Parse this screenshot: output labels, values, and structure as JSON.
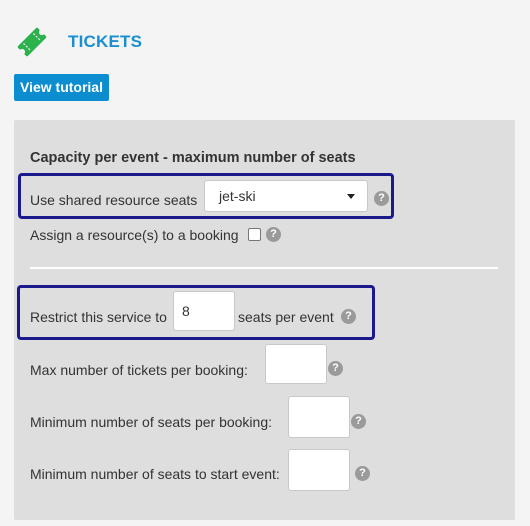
{
  "header": {
    "title": "TICKETS",
    "icon": "ticket-icon",
    "icon_color": "#2bb24c",
    "title_color": "#1a8fd0"
  },
  "toolbar": {
    "tutorial_label": "View tutorial"
  },
  "capacity": {
    "section_title": "Capacity per event - maximum number of seats",
    "shared_resource_label": "Use shared resource seats",
    "shared_resource_value": "jet-ski",
    "assign_resource_label": "Assign a resource(s) to a booking",
    "assign_resource_checked": false,
    "restrict_prefix": "Restrict this service to",
    "restrict_value": "8",
    "restrict_suffix": "seats per event",
    "max_tickets_label": "Max number of tickets per booking:",
    "max_tickets_value": "",
    "min_seats_label": "Minimum number of seats per booking:",
    "min_seats_value": "",
    "min_start_label": "Minimum number of seats to start event:",
    "min_start_value": "",
    "help_glyph": "?"
  },
  "colors": {
    "accent": "#0b8dcf",
    "highlight_border": "#1a1a8c",
    "panel_bg": "#dedede"
  }
}
